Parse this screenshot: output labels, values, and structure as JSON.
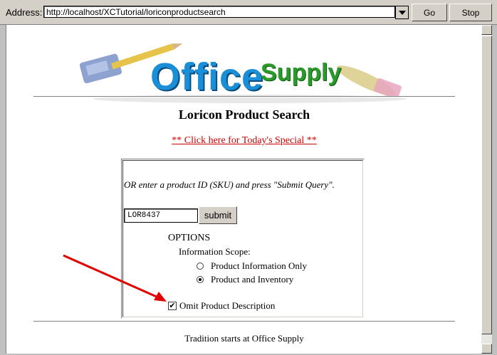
{
  "address_bar": {
    "label": "Address:",
    "url": "http://localhost/XCTutorial/loriconproductsearch",
    "go_label": "Go",
    "stop_label": "Stop"
  },
  "logo": {
    "word1": "Office",
    "word2": "Supply"
  },
  "page": {
    "title": "Loricon Product Search",
    "special_link": "** Click here for Today's Special **",
    "prompt": "OR enter a product ID (SKU) and press \"Submit Query\".",
    "sku_value": "LOR8437",
    "submit_label": "submit",
    "options_heading": "OPTIONS",
    "scope_label": "Information Scope:",
    "radio_options": [
      {
        "label": "Product Information Only",
        "selected": false
      },
      {
        "label": "Product and Inventory",
        "selected": true
      }
    ],
    "omit_description_label": "Omit Product Description",
    "omit_description_checked": true,
    "footer": "Tradition starts at Office Supply"
  },
  "colors": {
    "link": "#cc0000",
    "arrow": "#e00000",
    "logo_blue": "#1a8fd8",
    "logo_green": "#2a9a2a"
  }
}
